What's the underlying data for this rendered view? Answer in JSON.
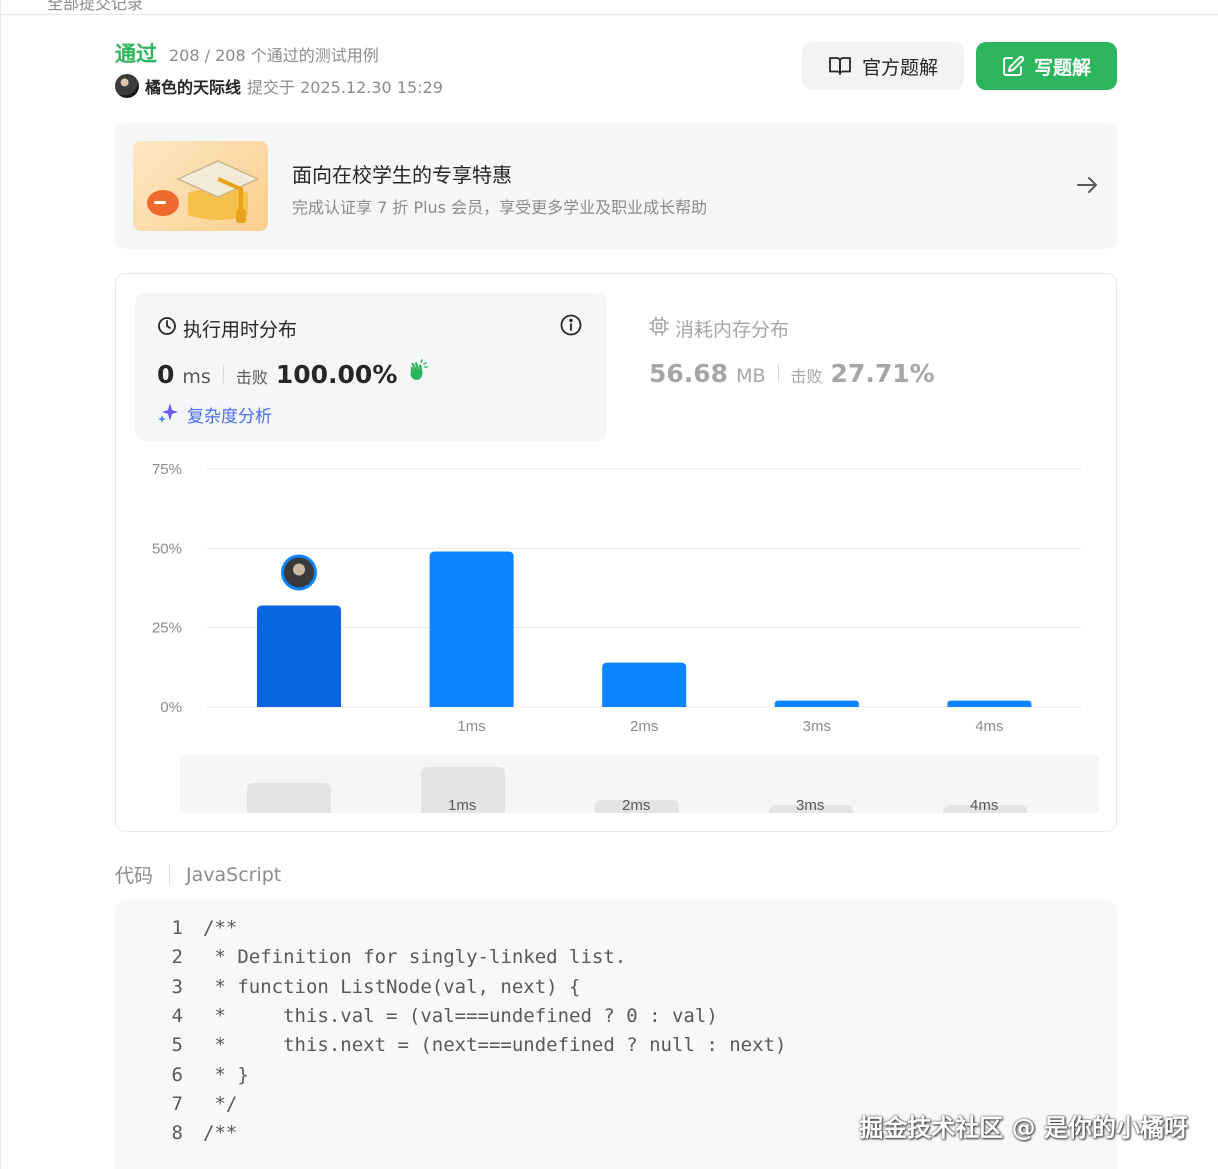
{
  "header": {
    "top_cut_text": "全部提交记录",
    "status": "通过",
    "test_summary": "208 / 208 个通过的测试用例",
    "submitter_name": "橘色的天际线",
    "submitted_at": "提交于 2025.12.30 15:29",
    "official_solution_label": "官方题解",
    "write_solution_label": "写题解"
  },
  "promo": {
    "title": "面向在校学生的专享特惠",
    "subtitle": "完成认证享 7 折 Plus 会员，享受更多学业及职业成长帮助"
  },
  "runtime": {
    "title": "执行用时分布",
    "value": "0",
    "unit": "ms",
    "beat_label": "击败",
    "beat_value": "100.00%",
    "complexity_link": "复杂度分析"
  },
  "memory": {
    "title": "消耗内存分布",
    "value": "56.68",
    "unit": "MB",
    "beat_label": "击败",
    "beat_value": "27.71%"
  },
  "chart_data": {
    "type": "bar",
    "categories": [
      "",
      "1ms",
      "2ms",
      "3ms",
      "4ms"
    ],
    "values": [
      32,
      49,
      14,
      2,
      2
    ],
    "highlighted_index": 0,
    "ylim": [
      0,
      75
    ],
    "yticks": [
      "0%",
      "25%",
      "50%",
      "75%"
    ],
    "ytick_values": [
      0,
      25,
      50,
      75
    ],
    "grid": true,
    "colors": {
      "bar": "#0a84ff",
      "highlight": "#0866de",
      "grid": "#e8e8e8"
    }
  },
  "brush": {
    "labels": [
      "",
      "1ms",
      "2ms",
      "3ms",
      "4ms"
    ]
  },
  "code": {
    "label": "代码",
    "language": "JavaScript",
    "lines": [
      {
        "n": "1",
        "text": "/**"
      },
      {
        "n": "2",
        "text": " * Definition for singly-linked list."
      },
      {
        "n": "3",
        "text": " * function ListNode(val, next) {"
      },
      {
        "n": "4",
        "text": " *     this.val = (val===undefined ? 0 : val)"
      },
      {
        "n": "5",
        "text": " *     this.next = (next===undefined ? null : next)"
      },
      {
        "n": "6",
        "text": " * }"
      },
      {
        "n": "7",
        "text": " */"
      },
      {
        "n": "8",
        "text": "/**"
      }
    ]
  },
  "watermark": "掘金技术社区 @ 是你的小橘呀"
}
